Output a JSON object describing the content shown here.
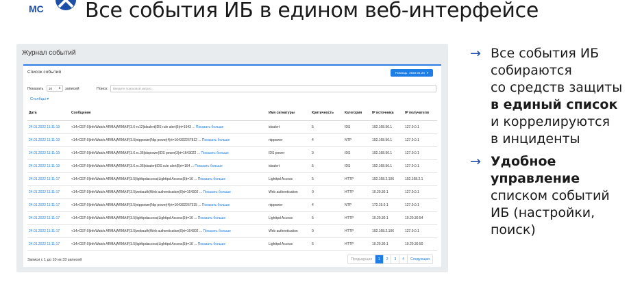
{
  "slide": {
    "title": "Все события ИБ в едином веб-интерфейсе",
    "logo_text": "МС"
  },
  "app": {
    "panel_title": "Журнал событий",
    "card_title": "Список событий",
    "period_label": "Помощь",
    "period_value": "2022.01.24",
    "show_label": "Показать",
    "show_value": "10",
    "records_label": "записей",
    "search_label": "Поиск:",
    "search_placeholder": "Введите поисковой запрос...",
    "columns_label": "Столбцы ▾",
    "records_info": "Записи с 1 до 10 из 33 записей",
    "more_label": "Показать больше",
    "headers": [
      "Дата",
      "Сообщение",
      "Имя сигнатуры",
      "Критичность",
      "Категория",
      "IP источника",
      "IP получателя"
    ],
    "rows": [
      {
        "date": "24.01.2022 11:11:19",
        "msg": "<14>CEF:0|InfoWatch ARMA|ARMAIF|3.6-rc12|idsalert|IDS rule alert|5|rt=1643 ...",
        "sig": "idsalert",
        "crit": "5",
        "cat": "IDS",
        "src": "192.168.56.1",
        "dst": "127.0.0.1"
      },
      {
        "date": "24.01.2022 11:11:19",
        "msg": "<14>CEF:0|InfoWatch ARMA|ARMAIF|3.5|ntppower|Ntp power|4|rt=164302267812 ...",
        "sig": "ntppower",
        "crit": "4",
        "cat": "NTP",
        "src": "192.168.56.1",
        "dst": "127.0.0.1"
      },
      {
        "date": "24.01.2022 11:11:19",
        "msg": "<14>CEF:0|InfoWatch ARMA|ARMAIF|3.6.rc.36|idspower|IDS power|3|rt=1643022 ...",
        "sig": "IDS power",
        "crit": "3",
        "cat": "IDS",
        "src": "192.168.56.1",
        "dst": "127.0.0.1"
      },
      {
        "date": "24.01.2022 11:11:19",
        "msg": "<14>CEF:0|InfoWatch ARMA|ARMAIF|3.6.rc.36|idsalert|IDS rule alert|5|rt=164 ...",
        "sig": "idsalert",
        "crit": "5",
        "cat": "IDS",
        "src": "192.168.56.1",
        "dst": "127.0.0.1"
      },
      {
        "date": "24.01.2022 11:11:17",
        "msg": "<14>CEF:0|InfoWatch ARMA|ARMAIF|3.5|lighttpdaccess|Lighttpd Access|5|t=16 ...",
        "sig": "Lighttpd Access",
        "crit": "5",
        "cat": "HTTP",
        "src": "192.168.2.106",
        "dst": "192.168.2.1"
      },
      {
        "date": "24.01.2022 11:11:17",
        "msg": "<14>CEF:0|InfoWatch ARMA|ARMAIF|3.5|webauth|Web authentication|0|rt=164302 ...",
        "sig": "Web authentication",
        "crit": "0",
        "cat": "HTTP",
        "src": "10.20.30.1",
        "dst": "127.0.0.1"
      },
      {
        "date": "24.01.2022 11:11:17",
        "msg": "<14>CEF:0|InfoWatch ARMA|ARMAIF|3.5|ntppower|Ntp power|4|rt=164302267315 ...",
        "sig": "ntppower",
        "crit": "4",
        "cat": "NTP",
        "src": "172.19.0.1",
        "dst": "127.0.0.1"
      },
      {
        "date": "24.01.2022 11:11:17",
        "msg": "<14>CEF:0|InfoWatch ARMA|ARMAIF|3.5|lighttpdaccess|Lighttpd Access|5|t=16 ...",
        "sig": "Lighttpd Access",
        "crit": "5",
        "cat": "HTTP",
        "src": "10.20.30.1",
        "dst": "10.20.30.54"
      },
      {
        "date": "24.01.2022 11:11:17",
        "msg": "<14>CEF:0|InfoWatch ARMA|ARMAIF|3.5|webauth|Web authentication|0|rt=164302 ...",
        "sig": "Web authentication",
        "crit": "0",
        "cat": "HTTP",
        "src": "192.168.2.106",
        "dst": "127.0.0.1"
      },
      {
        "date": "24.01.2022 11:11:17",
        "msg": "<14>CEF:0|InfoWatch ARMA|ARMAIF|3.5|lighttpdaccess|Lighttpd Access|5|t=16 ...",
        "sig": "Lighttpd Access",
        "crit": "5",
        "cat": "HTTP",
        "src": "10.20.30.1",
        "dst": "10.20.30.50"
      }
    ],
    "pager": {
      "prev": "Предыдущая",
      "pages": [
        "1",
        "2",
        "3",
        "4"
      ],
      "active": "1",
      "next": "Следующая"
    }
  },
  "bullets": {
    "b1_l1": "Все события ИБ",
    "b1_l2": "собираются",
    "b1_l3": "со средств защиты",
    "b1_l4": "в единый список",
    "b1_l5": "и коррелируются",
    "b1_l6": "в инциденты",
    "b2_l1": "Удобное",
    "b2_l2": "управление",
    "b2_l3": "списком событий",
    "b2_l4": "ИБ (настройки,",
    "b2_l5": "поиск)",
    "arrow": "→"
  },
  "colors": {
    "accent": "#1e7ee6",
    "arrow": "#1e4fa8",
    "logo": "#1e4fa8"
  }
}
